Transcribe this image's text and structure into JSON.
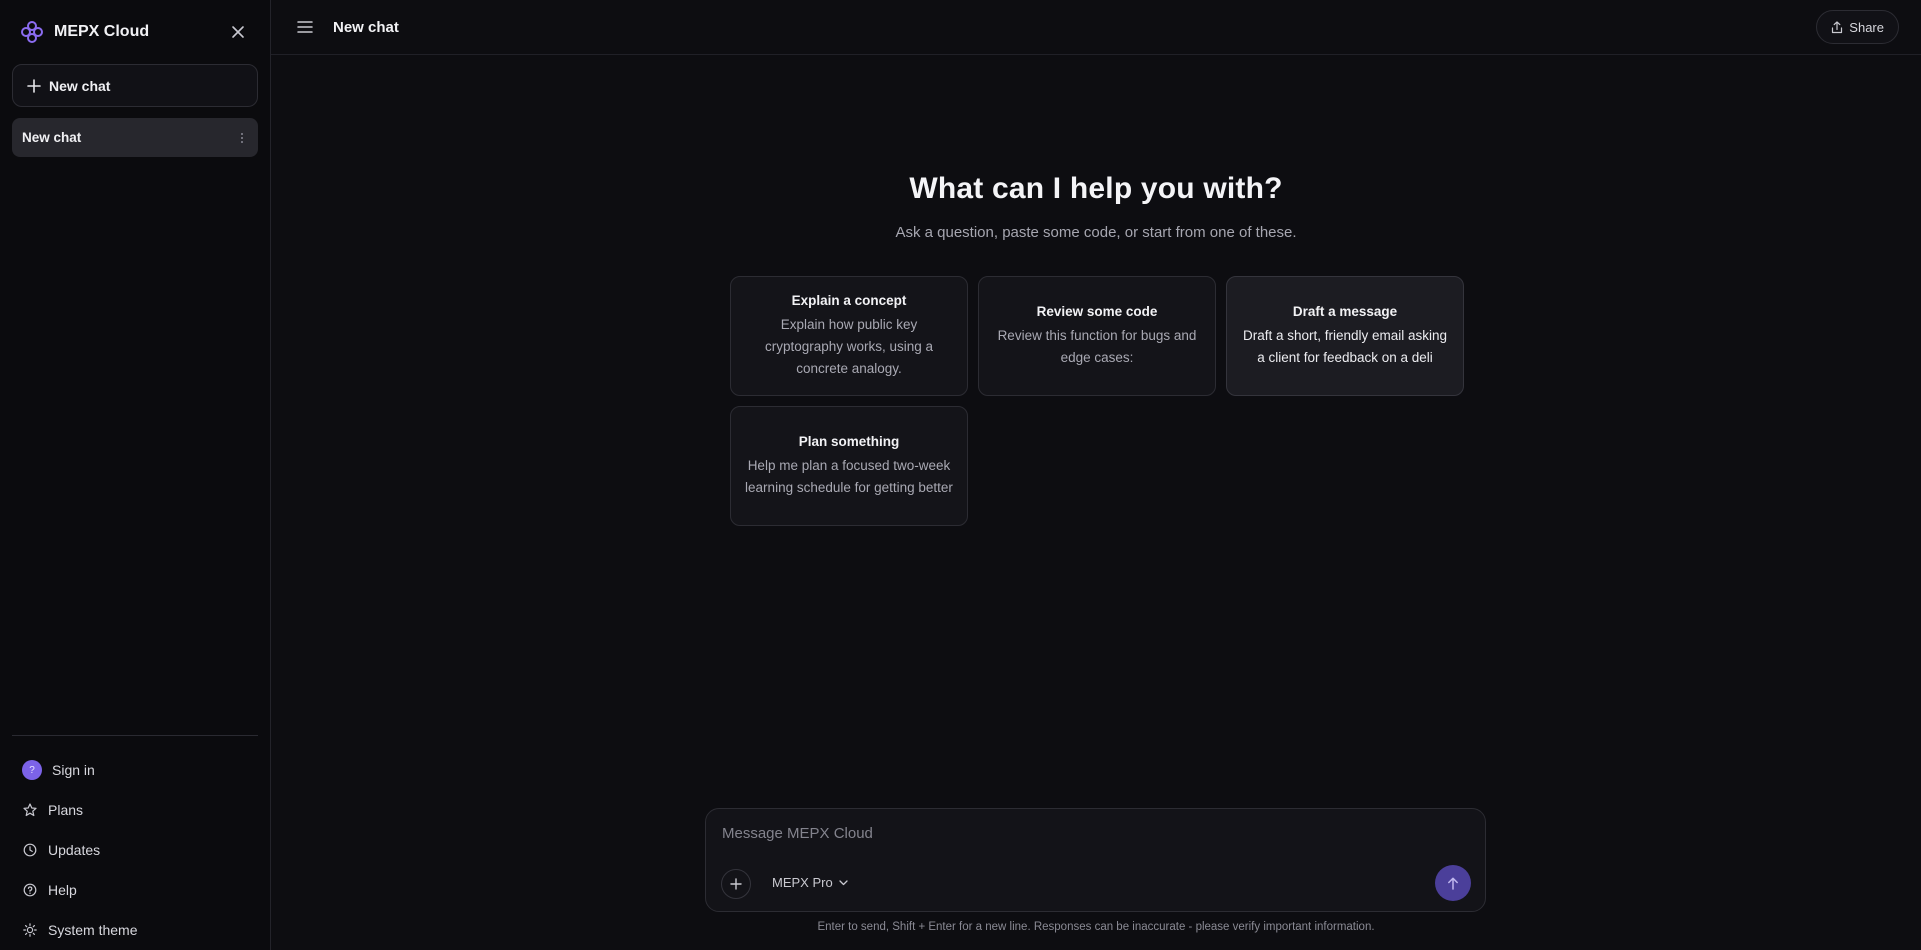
{
  "app": {
    "name": "MEPX Cloud"
  },
  "sidebar": {
    "new_chat_label": "New chat",
    "history": [
      {
        "label": "New chat"
      }
    ],
    "bottom": {
      "sign_in": {
        "label": "Sign in",
        "avatar_text": "?"
      },
      "plans": "Plans",
      "updates": "Updates",
      "help": "Help",
      "theme": "System theme"
    }
  },
  "header": {
    "title": "New chat",
    "share_label": "Share"
  },
  "hero": {
    "title": "What can I help you with?",
    "subtitle": "Ask a question, paste some code, or start from one of these."
  },
  "suggestions": [
    {
      "title": "Explain a concept",
      "body": "Explain how public key cryptography works, using a concrete analogy."
    },
    {
      "title": "Review some code",
      "body": "Review this function for bugs and edge cases:"
    },
    {
      "title": "Draft a message",
      "body": "Draft a short, friendly email asking a client for feedback on a deli"
    },
    {
      "title": "Plan something",
      "body": "Help me plan a focused two-week learning schedule for getting better"
    }
  ],
  "composer": {
    "placeholder": "Message MEPX Cloud",
    "value": "",
    "model": "MEPX Pro"
  },
  "disclaimer": "Enter to send, Shift + Enter for a new line. Responses can be inaccurate - please verify important information.",
  "colors": {
    "accent": "#7c63e8",
    "send": "#4b3f9a",
    "background": "#0d0d11"
  },
  "icons": {
    "brand": "mepx-logo-icon",
    "close": "close-icon",
    "plus": "plus-icon",
    "menu": "menu-icon",
    "share": "share-icon",
    "more": "more-vertical-icon",
    "star": "star-icon",
    "clock": "clock-icon",
    "help": "help-circle-icon",
    "sun": "sun-icon",
    "chevron": "chevron-down-icon",
    "send": "arrow-up-icon"
  }
}
